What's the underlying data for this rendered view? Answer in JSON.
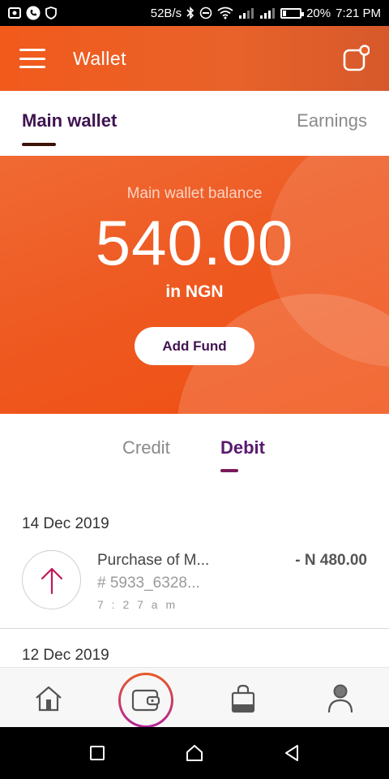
{
  "status_bar": {
    "speed": "52B/s",
    "battery_text": "20%",
    "battery_level": 0.2,
    "time": "7:21 PM"
  },
  "app_bar": {
    "title": "Wallet",
    "menu_icon": "hamburger-menu-icon",
    "action_icon": "chat-icon"
  },
  "wallet_tabs": {
    "main": "Main wallet",
    "earnings": "Earnings"
  },
  "balance": {
    "label": "Main wallet balance",
    "amount": "540.00",
    "currency": "in NGN",
    "add_fund": "Add Fund"
  },
  "transaction_tabs": {
    "credit": "Credit",
    "debit": "Debit",
    "active": "debit"
  },
  "transactions": [
    {
      "date": "14 Dec 2019",
      "title": "Purchase of M...",
      "ref": "# 5933_6328...",
      "time": "7 : 2 7 a m",
      "amount": "- N 480.00",
      "icon": "arrow-up-icon"
    },
    {
      "date": "12 Dec 2019"
    }
  ],
  "colors": {
    "brand_orange": "#f25a1c",
    "brand_purple": "#3f1450",
    "debit_accent": "#7a1a5a",
    "arrow_pink": "#c2185b"
  },
  "bottom_nav": {
    "items": [
      "home-icon",
      "wallet-icon",
      "shopping-bag-icon",
      "profile-icon"
    ],
    "active": "wallet-icon"
  }
}
